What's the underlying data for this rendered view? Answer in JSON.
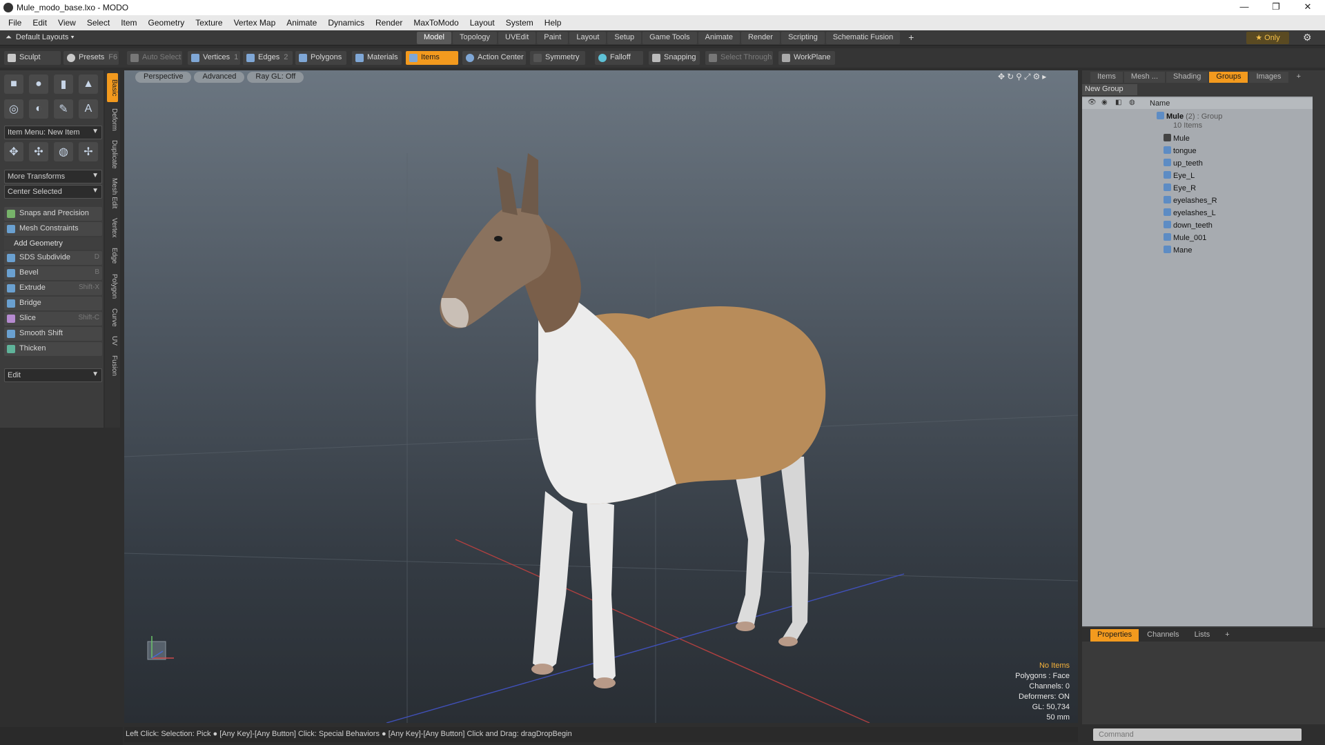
{
  "window": {
    "title": "Mule_modo_base.lxo - MODO",
    "controls": [
      "—",
      "❐",
      "✕"
    ]
  },
  "menu": [
    "File",
    "Edit",
    "View",
    "Select",
    "Item",
    "Geometry",
    "Texture",
    "Vertex Map",
    "Animate",
    "Dynamics",
    "Render",
    "MaxToModo",
    "Layout",
    "System",
    "Help"
  ],
  "layout": {
    "current": "Default Layouts",
    "tabs": [
      "Model",
      "Topology",
      "UVEdit",
      "Paint",
      "Layout",
      "Setup",
      "Game Tools",
      "Animate",
      "Render",
      "Scripting",
      "Schematic Fusion"
    ],
    "active_tab": "Model",
    "add": "+",
    "only_label": "★ Only"
  },
  "toolbar": {
    "sculpt": "Sculpt",
    "presets": "Presets",
    "presets_key": "F6",
    "auto_select": "Auto Select",
    "vertices": "Vertices",
    "vertices_key": "1",
    "edges": "Edges",
    "edges_key": "2",
    "polygons": "Polygons",
    "materials": "Materials",
    "items": "Items",
    "action_center": "Action Center",
    "symmetry": "Symmetry",
    "falloff": "Falloff",
    "snapping": "Snapping",
    "select_through": "Select Through",
    "workplane": "WorkPlane"
  },
  "left": {
    "item_menu": "Item Menu: New Item",
    "more_transforms": "More Transforms",
    "center_selected": "Center Selected",
    "snaps": "Snaps and Precision",
    "mesh_constraints": "Mesh Constraints",
    "add_geometry": "Add Geometry",
    "tools": [
      {
        "label": "SDS Subdivide",
        "key": "D"
      },
      {
        "label": "Bevel",
        "key": "B"
      },
      {
        "label": "Extrude",
        "key": "Shift-X"
      },
      {
        "label": "Bridge",
        "key": ""
      },
      {
        "label": "Slice",
        "key": "Shift-C"
      },
      {
        "label": "Smooth Shift",
        "key": ""
      },
      {
        "label": "Thicken",
        "key": ""
      }
    ],
    "edit": "Edit",
    "vtabs": [
      "Basic",
      "Deform",
      "Duplicate",
      "Mesh Edit",
      "Vertex",
      "Edge",
      "Polygon",
      "Curve",
      "UV",
      "Fusion"
    ]
  },
  "viewport": {
    "tabs": [
      "Perspective",
      "Advanced",
      "Ray GL: Off"
    ],
    "stats": {
      "no_items": "No Items",
      "polygons": "Polygons : Face",
      "channels": "Channels: 0",
      "deformers": "Deformers: ON",
      "gl": "GL: 50,734",
      "mm": "50 mm"
    }
  },
  "status": "Left Click: Selection: Pick ● [Any Key]-[Any Button] Click: Special Behaviors ● [Any Key]-[Any Button] Click and Drag: dragDropBegin",
  "right": {
    "tabs": [
      "Items",
      "Mesh ...",
      "Shading",
      "Groups",
      "Images",
      "+"
    ],
    "active_tab": "Groups",
    "new_group": "New Group",
    "col_name": "Name",
    "group_name": "Mule",
    "group_count": "(2) : Group",
    "group_items": "10 Items",
    "items": [
      "Mule",
      "tongue",
      "up_teeth",
      "Eye_L",
      "Eye_R",
      "eyelashes_R",
      "eyelashes_L",
      "down_teeth",
      "Mule_001",
      "Mane"
    ],
    "prop_tabs": [
      "Properties",
      "Channels",
      "Lists",
      "+"
    ],
    "command_placeholder": "Command"
  },
  "colors": {
    "accent": "#f39a1e",
    "stats_highlight": "#f5b23a"
  }
}
